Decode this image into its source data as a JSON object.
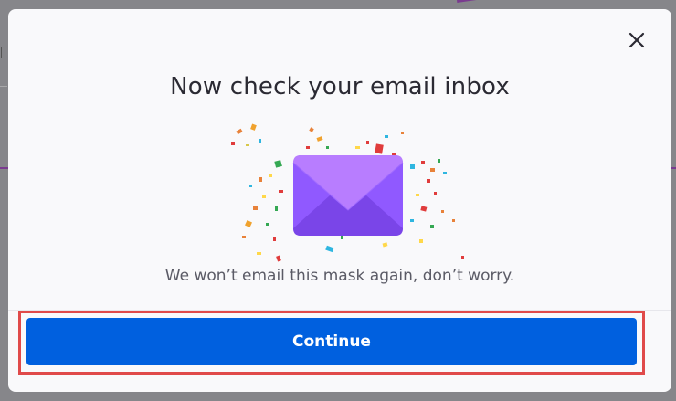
{
  "modal": {
    "title": "Now check your email inbox",
    "subtitle": "We won’t email this mask again, don’t worry.",
    "continue_label": "Continue",
    "close_icon": "close-icon",
    "illustration_icon": "envelope-confetti-icon"
  },
  "colors": {
    "primary_button": "#0060df",
    "envelope": "#9059ff",
    "highlight_border": "#e04a4a"
  }
}
